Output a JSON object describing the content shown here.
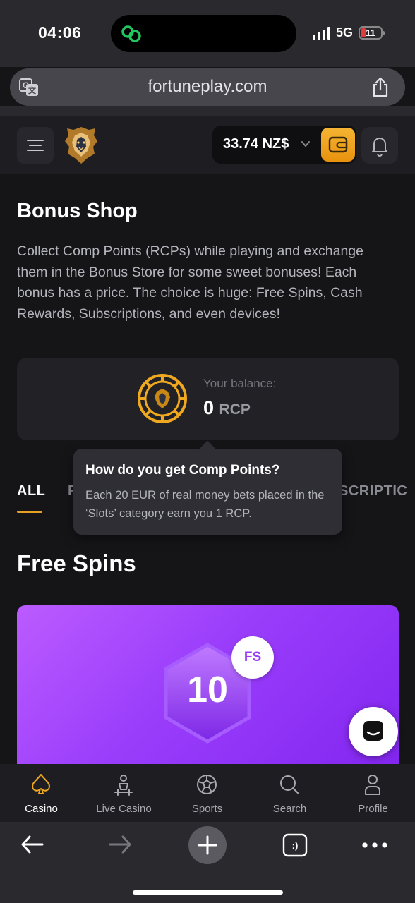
{
  "status": {
    "time": "04:06",
    "network": "5G",
    "battery": "11"
  },
  "browser": {
    "url": "fortuneplay.com"
  },
  "header": {
    "balance": "33.74 NZ$"
  },
  "page": {
    "title": "Bonus Shop",
    "description": "Collect Comp Points (RCPs) while playing and exchange them in the Bonus Store for some sweet bonuses! Each bonus has a price. The choice is huge: Free Spins, Cash Rewards, Subscriptions, and even devices!"
  },
  "balance_card": {
    "label": "Your balance:",
    "value": "0",
    "unit": "RCP"
  },
  "tabs": [
    {
      "label": "ALL",
      "active": true
    },
    {
      "label": "F"
    },
    {
      "label": "SCRIPTIC"
    }
  ],
  "tooltip": {
    "title": "How do you get Comp Points?",
    "body": "Each 20 EUR of real money bets placed in the ‘Slots’ category earn you 1 RCP."
  },
  "section": {
    "title": "Free Spins"
  },
  "promo": {
    "value": "10",
    "badge": "FS"
  },
  "bottom_nav": [
    {
      "label": "Casino",
      "icon": "spade-icon",
      "active": true
    },
    {
      "label": "Live Casino",
      "icon": "dealer-icon"
    },
    {
      "label": "Sports",
      "icon": "soccer-ball-icon"
    },
    {
      "label": "Search",
      "icon": "search-icon"
    },
    {
      "label": "Profile",
      "icon": "user-icon"
    }
  ],
  "colors": {
    "accent": "#e8a022",
    "promo": "#9a3dfb",
    "background": "#151518"
  }
}
